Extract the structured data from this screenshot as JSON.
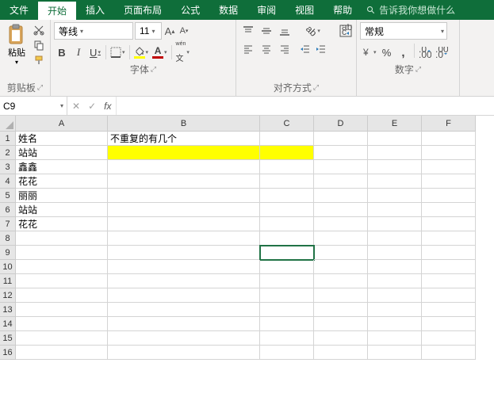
{
  "menu": {
    "file": "文件",
    "home": "开始",
    "insert": "插入",
    "layout": "页面布局",
    "formulas": "公式",
    "data": "数据",
    "review": "审阅",
    "view": "视图",
    "help": "帮助",
    "tellme": "告诉我你想做什么"
  },
  "ribbon": {
    "clipboard": {
      "paste": "粘贴",
      "label": "剪贴板"
    },
    "font": {
      "name": "等线",
      "size": "11",
      "label": "字体"
    },
    "align": {
      "label": "对齐方式"
    },
    "number": {
      "format": "常规",
      "label": "数字"
    }
  },
  "namebox": "C9",
  "formula": "",
  "cols": [
    "A",
    "B",
    "C",
    "D",
    "E",
    "F"
  ],
  "rows": [
    "1",
    "2",
    "3",
    "4",
    "5",
    "6",
    "7",
    "8",
    "9",
    "10",
    "11",
    "12",
    "13",
    "14",
    "15",
    "16"
  ],
  "cells": {
    "A1": "姓名",
    "B1": "不重复的有几个",
    "A2": "站站",
    "A3": "鑫鑫",
    "A4": "花花",
    "A5": "丽丽",
    "A6": "站站",
    "A7": "花花"
  },
  "selected": "C9",
  "highlight": [
    "B2",
    "C2"
  ]
}
